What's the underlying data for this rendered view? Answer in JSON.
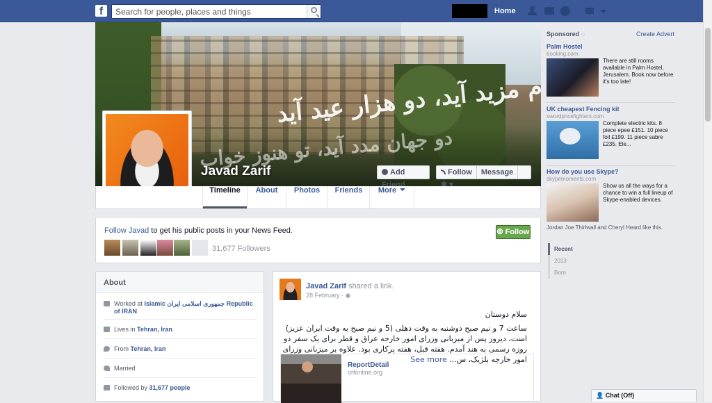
{
  "topbar": {
    "search_placeholder": "Search for people, places and things",
    "home_label": "Home"
  },
  "profile": {
    "name": "Javad Zarif",
    "add_friend_label": "Add Friend",
    "follow_label": "Follow",
    "message_label": "Message",
    "cover_text_line1": "زکرم مزید آید، دو هزار عید آید",
    "cover_text_line2": "دو جهان مدد آید، تو هنوز خواب نماید"
  },
  "tabs": [
    {
      "label": "Timeline"
    },
    {
      "label": "About"
    },
    {
      "label": "Photos"
    },
    {
      "label": "Friends"
    },
    {
      "label": "More"
    }
  ],
  "follow_box": {
    "follow_link": "Follow Javad",
    "text": " to get his public posts in your News Feed.",
    "button_label": "Follow",
    "followers": "31,677 Followers"
  },
  "about": {
    "heading": "About",
    "work_prefix": "Worked at ",
    "work_place": "Islamic جمهوری اسلامی ایران Republic of IRAN",
    "lives_prefix": "Lives in ",
    "lives_place": "Tehran, Iran",
    "from_prefix": "From ",
    "from_place": "Tehran, Iran",
    "married": "Married",
    "followed_prefix": "Followed by ",
    "followed_count": "31,677 people"
  },
  "post": {
    "author": "Javad Zarif",
    "action": " shared a link.",
    "date": "28 February",
    "greeting": "سلام دوستان",
    "body": "ساعت 7 و نیم صبح دوشنبه به وقت دهلی (5 و نیم صبح به وقت ایران عزیز) است، دیروز پس از میزبانی وزرای امور خارجه عراق و قطر برای یک سفر دو روزه رسمی به هند آمدم. هفته قبل، هفته پرکاری بود. علاوه بر میزبانی وزرای امور خارجه بلژیک، س...",
    "see_more": "See more",
    "link_title": "ReportDetail",
    "link_url": "orfonline.org"
  },
  "sidebar": {
    "sponsored_label": "Sponsored",
    "create_advert": "Create Advert",
    "ads": [
      {
        "title": "Palm Hostel",
        "url": "booking.com",
        "body": "There are still rooms available in Palm Hostel, Jerusalem. Book now before it's too late!"
      },
      {
        "title": "UK cheapest Fencing kit",
        "url": "swordpricefighters.com",
        "body": "Complete electric kits. 8 piece epee £151. 10 piece foil £199. 11 piece sabre £235. Ele..."
      },
      {
        "title": "How do you use Skype?",
        "url": "skypemoments.com",
        "body": "Show us all the ways for a chance to win a full lineup of Skype-enabled devices."
      }
    ],
    "likes_line": "Jordan Joe Thirlwall and Cheryl Heard like this.",
    "years": [
      "Recent",
      "2013",
      "Born"
    ]
  },
  "chat": {
    "label": "Chat (Off)"
  }
}
